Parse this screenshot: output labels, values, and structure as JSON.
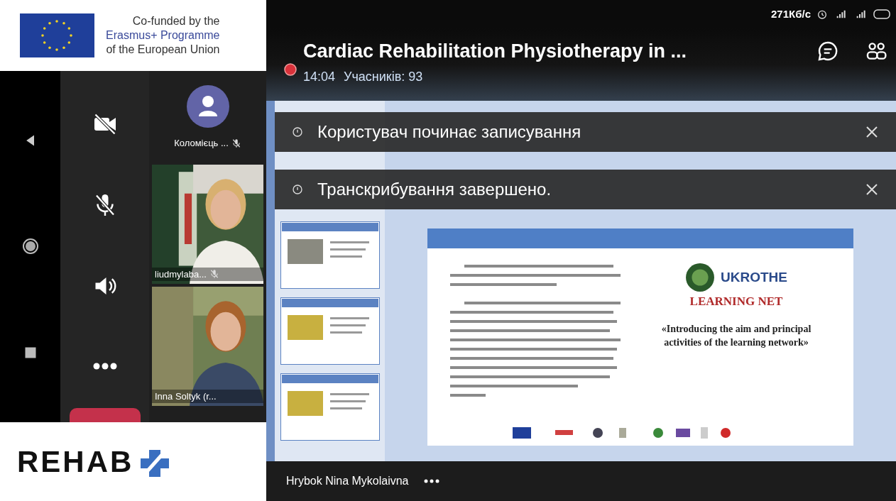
{
  "funding_logo": {
    "lines": [
      "Co-funded by the",
      "Erasmus+ Programme",
      "of the European Union"
    ]
  },
  "status_bar": {
    "speed": "271Кб/с"
  },
  "meeting": {
    "title": "Cardiac Rehabilitation Physiotherapy in ...",
    "recording": true,
    "time": "14:04",
    "participants_count": "Учасників: 93"
  },
  "controls": [
    {
      "kind": "camera-off"
    },
    {
      "kind": "mic-off"
    },
    {
      "kind": "speaker"
    },
    {
      "kind": "more"
    }
  ],
  "participants": [
    {
      "kind": "avatar",
      "name": "Коломієць ...",
      "muted": true
    },
    {
      "kind": "video",
      "name": "liudmylaba...",
      "muted": true
    },
    {
      "kind": "video",
      "name": "Inna Soltyk (r...",
      "muted": false
    }
  ],
  "notifications": [
    {
      "text": "Користувач починає записування"
    },
    {
      "text": "Транскрибування завершено."
    }
  ],
  "slide": {
    "brand": "UKROTHE",
    "heading": "LEARNING NET",
    "quote": "«Introducing the aim and principal activities of the learning network»"
  },
  "presenter": {
    "name": "Hrybok Nina Mykolaivna"
  },
  "bottom_logo": {
    "name": "REHAB"
  }
}
